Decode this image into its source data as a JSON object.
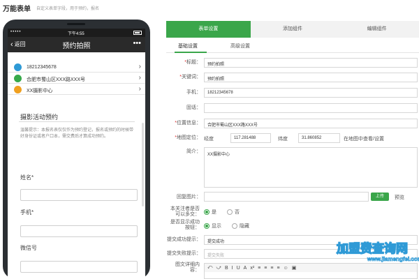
{
  "header": {
    "title": "万能表单",
    "description": "自定义表单字段，用于预约，报名"
  },
  "phone": {
    "status": {
      "signal": "•••••",
      "time": "下午4:55"
    },
    "nav": {
      "back_label": "返回",
      "title": "预约拍照",
      "more": "•••"
    },
    "info_rows": [
      {
        "icon": "phone-icon",
        "color": "#2f9ad6",
        "text": "18212345678"
      },
      {
        "icon": "location-icon",
        "color": "#37a94a",
        "text": "合肥市蜀山区XXX路XXX号"
      },
      {
        "icon": "pencil-icon",
        "color": "#f0a020",
        "text": "XX摄影中心"
      }
    ],
    "activity_title": "摄影活动预约",
    "notice": "温馨提示：本报名表仅仅作为预约登记，报名或预约的时候带好身份证或者户口本，需交费后才算成功预约。",
    "fields": [
      {
        "label": "姓名*"
      },
      {
        "label": "手机*"
      },
      {
        "label": "微信号"
      }
    ]
  },
  "tabs": [
    "表单设置",
    "添加组件",
    "编辑组件"
  ],
  "subtabs": [
    "基础设置",
    "高级设置"
  ],
  "form": {
    "title": {
      "label": "标题：",
      "value": "预约拍照"
    },
    "keyword": {
      "label": "关键词：",
      "value": "预约拍照"
    },
    "phone": {
      "label": "手机：",
      "value": "18212345678"
    },
    "phone2": {
      "label": "固话：",
      "value": ""
    },
    "address": {
      "label": "位置信息：",
      "value": "合肥市蜀山区XXX路XXX号"
    },
    "geo": {
      "label": "地图定位：",
      "lng_label": "经度",
      "lng": "117.281488",
      "lat_label": "纬度",
      "lat": "31.860852",
      "map_link": "在地图中查看/设置"
    },
    "intro": {
      "label": "简介：",
      "value": "XX摄影中心"
    },
    "cover": {
      "label": "回复图片：",
      "upload": "上传",
      "preview": "预览"
    },
    "single_submit": {
      "label": "本关注者是否可以多交：",
      "options": [
        "是",
        "否"
      ],
      "selected": 0
    },
    "show_success": {
      "label": "是否显示成功按钮：",
      "options": [
        "显示",
        "隐藏"
      ],
      "selected": 0
    },
    "success_msg": {
      "label": "提交成功提示：",
      "value": "提交成功"
    },
    "fail_msg": {
      "label": "提交失败提示：",
      "value": "提交失败"
    },
    "content": {
      "label": "图文详细内容："
    }
  },
  "editor_tools": [
    "⤺",
    "⤻",
    "B",
    "I",
    "U",
    "A",
    "x²",
    "≡",
    "≡",
    "≡",
    "≡",
    "☺",
    "▣"
  ],
  "watermark": {
    "logo": "加盟费查询网",
    "url": "www.jiamengfei.com"
  },
  "colors": {
    "accent": "#3aa64a",
    "phone_body": "#2b2f33",
    "watermark": "#2f9ad6"
  }
}
